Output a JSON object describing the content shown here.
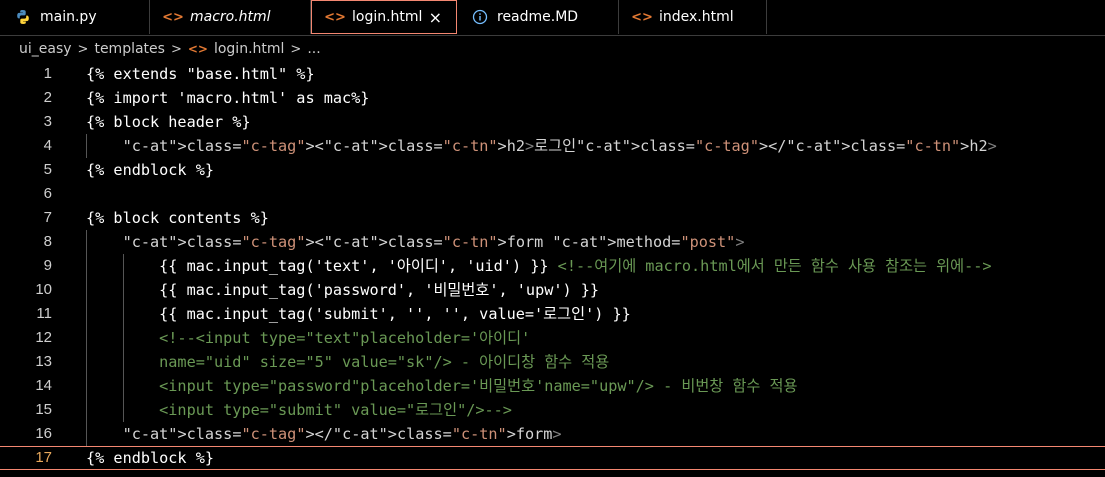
{
  "tabs": [
    {
      "label": "main.py",
      "icon": "python-icon"
    },
    {
      "label": "macro.html",
      "icon": "html-icon"
    },
    {
      "label": "login.html",
      "icon": "html-icon",
      "active": true,
      "close": "×"
    },
    {
      "label": "readme.MD",
      "icon": "info-icon"
    },
    {
      "label": "index.html",
      "icon": "html-icon"
    }
  ],
  "breadcrumb": [
    "ui_easy",
    "templates",
    "login.html",
    "..."
  ],
  "editor": {
    "active_line": 17,
    "lines": [
      {
        "n": "1",
        "text": "{% extends \"base.html\" %}"
      },
      {
        "n": "2",
        "text": "{% import 'macro.html' as mac%}"
      },
      {
        "n": "3",
        "text": "{% block header %}"
      },
      {
        "n": "4",
        "text": "    <h2>로그인</h2>"
      },
      {
        "n": "5",
        "text": "{% endblock %}"
      },
      {
        "n": "6",
        "text": ""
      },
      {
        "n": "7",
        "text": "{% block contents %}"
      },
      {
        "n": "8",
        "text": "    <form method=\"post\">"
      },
      {
        "n": "9",
        "text": "        {{ mac.input_tag('text', '아이디', 'uid') }} <!--여기에 macro.html에서 만든 함수 사용 참조는 위에-->"
      },
      {
        "n": "10",
        "text": "        {{ mac.input_tag('password', '비밀번호', 'upw') }}"
      },
      {
        "n": "11",
        "text": "        {{ mac.input_tag('submit', '', '', value='로그인') }}"
      },
      {
        "n": "12",
        "text": "        <!--<input type=\"text\"placeholder='아이디'"
      },
      {
        "n": "13",
        "text": "        name=\"uid\" size=\"5\" value=\"sk\"/> - 아이디창 함수 적용"
      },
      {
        "n": "14",
        "text": "        <input type=\"password\"placeholder='비밀번호'name=\"upw\"/> - 비번창 함수 적용"
      },
      {
        "n": "15",
        "text": "        <input type=\"submit\" value=\"로그인\"/>-->"
      },
      {
        "n": "16",
        "text": "    </form>"
      },
      {
        "n": "17",
        "text": "{% endblock %}"
      }
    ]
  },
  "colors": {
    "background": "#000000",
    "keyword": "#ffffff",
    "tag": "#569cd6",
    "attribute": "#9cdcfe",
    "string": "#ce9178",
    "comment": "#6a9955",
    "accent": "#f48771"
  }
}
